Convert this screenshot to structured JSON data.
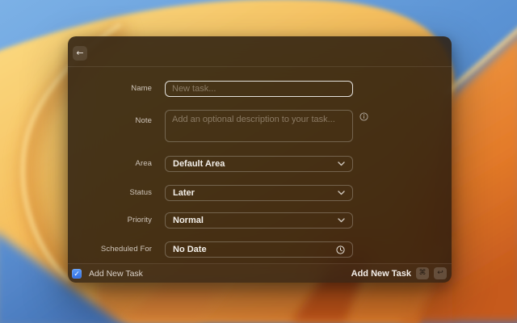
{
  "window": {
    "header": {
      "back_glyph": "←"
    },
    "form": {
      "fields": [
        {
          "label": "Name",
          "type": "text",
          "placeholder": "New task..."
        },
        {
          "label": "Note",
          "type": "textarea",
          "placeholder": "Add an optional description to your task..."
        },
        {
          "label": "Area",
          "type": "select",
          "value": "Default Area"
        },
        {
          "label": "Status",
          "type": "select",
          "value": "Later"
        },
        {
          "label": "Priority",
          "type": "select",
          "value": "Normal"
        },
        {
          "label": "Scheduled For",
          "type": "date",
          "value": "No Date"
        }
      ]
    },
    "footer": {
      "checkbox": {
        "label": "Add New Task",
        "checked": true,
        "check_glyph": "✓"
      },
      "submit": {
        "label": "Add New Task",
        "keys": [
          "⌘",
          "↩"
        ]
      }
    }
  },
  "icons": {
    "back": "back-arrow",
    "info": "info-circle",
    "chevron": "chevron-down",
    "clock": "clock",
    "checkmark": "checkmark"
  },
  "colors": {
    "accent_blue": "#3f7be8",
    "window_tint": "rgba(34,24,16,0.84)",
    "focused_border": "rgba(255,255,255,0.85)",
    "wallpaper_sky": "#6aa2de",
    "wallpaper_dune_light": "#fbdd85",
    "wallpaper_dune_deep": "#ec9a3e",
    "wallpaper_orange": "#d96a26",
    "wallpaper_bottom_blue": "#4a7cc2"
  }
}
